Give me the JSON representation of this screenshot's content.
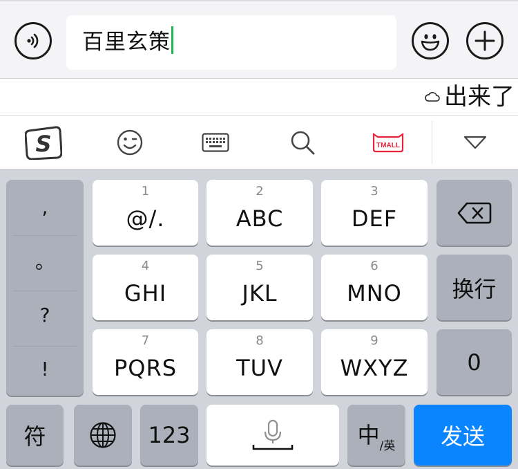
{
  "input_bar": {
    "message_text": "百里玄策",
    "voice_icon": "voice-waves-icon",
    "emoji_icon": "smiley-face-icon",
    "plus_icon": "plus-circle-icon"
  },
  "candidate_bar": {
    "cloud_icon": "cloud-icon",
    "candidate": "出来了"
  },
  "toolbar": {
    "items": [
      "sogou-logo-icon",
      "emoji-face-icon",
      "keyboard-icon",
      "search-icon",
      "tmall-icon",
      "collapse-triangle-icon"
    ],
    "tmall_label": "TMALL",
    "accent_color": "#e8233c"
  },
  "keyboard": {
    "punctuation": [
      ",",
      "。",
      "?",
      "!"
    ],
    "keys": [
      {
        "num": "1",
        "letters": "@/."
      },
      {
        "num": "2",
        "letters": "ABC"
      },
      {
        "num": "3",
        "letters": "DEF"
      },
      {
        "num": "4",
        "letters": "GHI"
      },
      {
        "num": "5",
        "letters": "JKL"
      },
      {
        "num": "6",
        "letters": "MNO"
      },
      {
        "num": "7",
        "letters": "PQRS"
      },
      {
        "num": "8",
        "letters": "TUV"
      },
      {
        "num": "9",
        "letters": "WXYZ"
      }
    ],
    "backspace_icon": "backspace-icon",
    "newline_label": "换行",
    "zero_label": "0",
    "symbols_label": "符",
    "globe_icon": "globe-icon",
    "numbers_label": "123",
    "mic_icon": "microphone-icon",
    "lang_main": "中",
    "lang_sub": "/英",
    "send_label": "发送",
    "send_color": "#0a84ff"
  }
}
